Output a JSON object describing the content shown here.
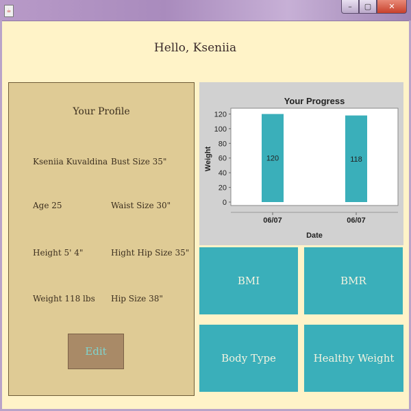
{
  "window": {
    "app_icon_glyph": "☕",
    "minimize_glyph": "–",
    "maximize_glyph": "▢",
    "close_glyph": "✕"
  },
  "greeting": "Hello, Kseniia",
  "profile": {
    "title": "Your Profile",
    "name": "Kseniia Kuvaldina",
    "bust": "Bust Size 35\"",
    "age": "Age 25",
    "waist": "Waist Size 30\"",
    "height": "Height 5' 4\"",
    "hight_hip": "Hight Hip Size 35\"",
    "weight": "Weight 118 lbs",
    "hip": "Hip Size 38\"",
    "edit_label": "Edit"
  },
  "tiles": {
    "bmi": "BMI",
    "bmr": "BMR",
    "body_type": "Body Type",
    "healthy_weight": "Healthy Weight"
  },
  "colors": {
    "background": "#fff3c8",
    "profile_bg": "#dfcb95",
    "tile_bg": "#3aafba",
    "bar": "#3aafba",
    "chart_bg": "#d1d1d1"
  },
  "chart_data": {
    "type": "bar",
    "title": "Your Progress",
    "xlabel": "Date",
    "ylabel": "Weight",
    "categories": [
      "06/07",
      "06/07"
    ],
    "values": [
      120,
      118
    ],
    "data_labels": [
      "120",
      "118"
    ],
    "ylim": [
      0,
      126
    ],
    "yticks": [
      0,
      20,
      40,
      60,
      80,
      100,
      120
    ],
    "grid": false,
    "legend": "none"
  }
}
